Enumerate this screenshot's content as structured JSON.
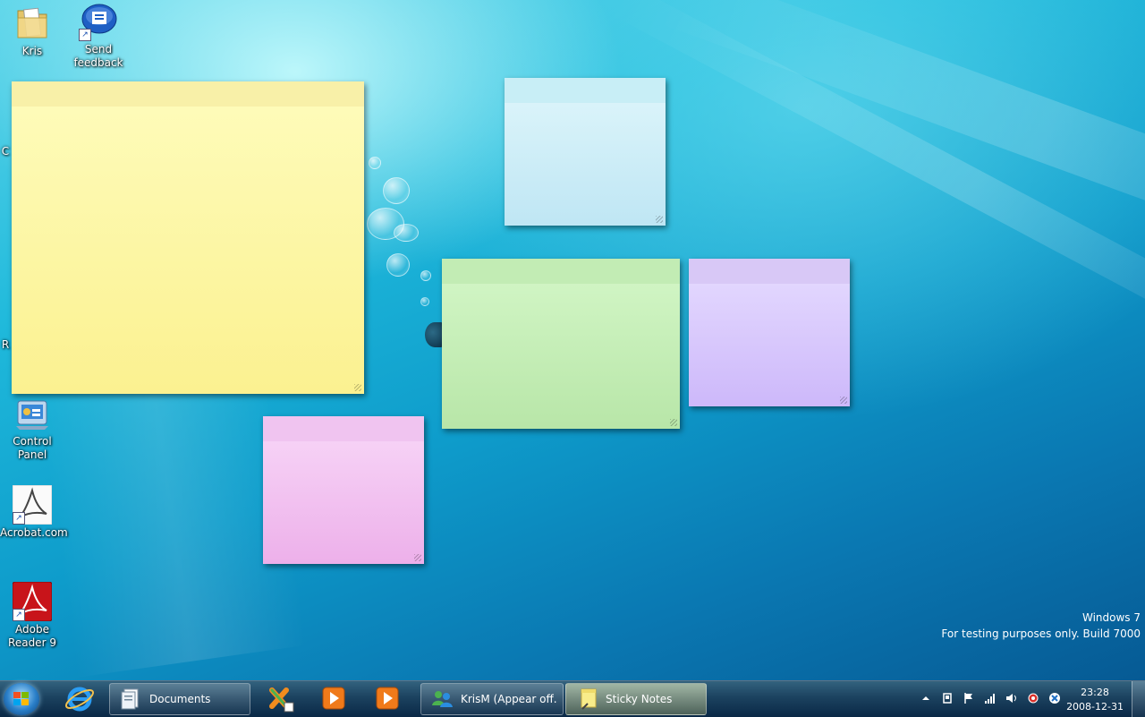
{
  "desktop": {
    "icons": [
      {
        "label": "Kris",
        "icon": "folder-icon"
      },
      {
        "label": "Send feedback",
        "icon": "feedback-icon"
      },
      {
        "label": "Control Panel",
        "icon": "control-panel-icon"
      },
      {
        "label": "Acrobat.com",
        "icon": "acrobat-com-icon"
      },
      {
        "label": "Adobe Reader 9",
        "icon": "adobe-reader-icon"
      }
    ],
    "partial_labels": [
      "C",
      "R"
    ]
  },
  "sticky_notes": [
    {
      "color_bar": "#f8f0a8",
      "color_top": "#fefcbc",
      "color_bottom": "#fbf190"
    },
    {
      "color_bar": "#c8eef6",
      "color_top": "#dff6fb",
      "color_bottom": "#bfe6f4"
    },
    {
      "color_bar": "#c2ecb4",
      "color_top": "#d4f7c8",
      "color_bottom": "#b8e6a8"
    },
    {
      "color_bar": "#d8c8f6",
      "color_top": "#e6dcff",
      "color_bottom": "#cdb8fa"
    },
    {
      "color_bar": "#f0c4f0",
      "color_top": "#f8d8f8",
      "color_bottom": "#edb0ea"
    }
  ],
  "watermark": {
    "line1": "Windows  7",
    "line2": "For testing purposes only. Build 7000"
  },
  "taskbar": {
    "start": "windows-start-icon",
    "buttons": [
      {
        "label": "Documents",
        "icon": "documents-icon"
      },
      {
        "label": "KrisM (Appear off...",
        "icon": "messenger-icon"
      },
      {
        "label": "Sticky Notes",
        "icon": "sticky-notes-icon"
      }
    ],
    "pinned": [
      "internet-explorer-icon",
      "live-messenger-icon",
      "media-player-icon",
      "media-center-icon"
    ]
  },
  "tray": {
    "icons": [
      "show-hidden-icon",
      "network-icon",
      "action-center-flag-icon",
      "signal-icon",
      "volume-icon",
      "security-icon",
      "messenger-status-icon"
    ],
    "time": "23:28",
    "date": "2008-12-31"
  }
}
